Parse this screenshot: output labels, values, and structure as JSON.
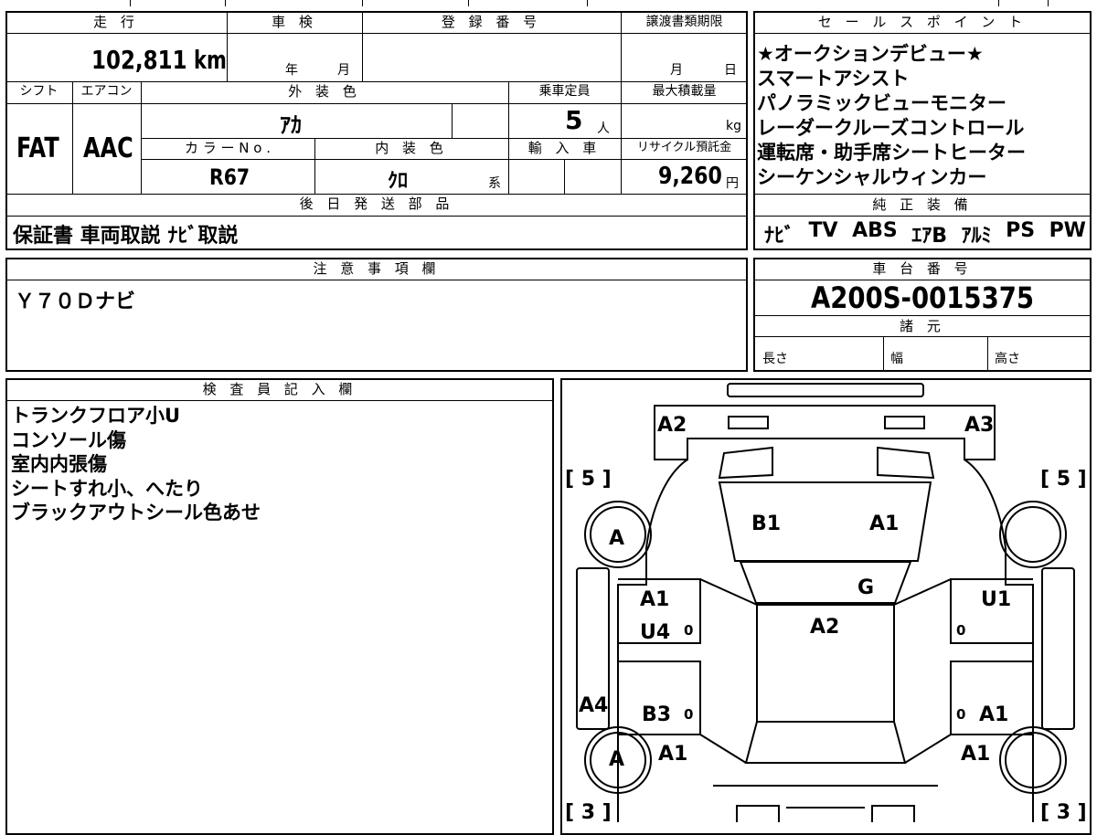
{
  "header": {
    "mileage_label": "走 行",
    "mileage_value": "102,811",
    "mileage_unit": "km",
    "inspection_label": "車 検",
    "inspection_year": "年",
    "inspection_month": "月",
    "registration_label": "登 録 番 号",
    "transfer_label": "譲渡書類期限",
    "transfer_month": "月",
    "transfer_day": "日"
  },
  "specs": {
    "shift_label": "シフト",
    "shift_value": "FAT",
    "ac_label": "エアコン",
    "ac_value": "AAC",
    "exterior_color_label": "外 装 色",
    "exterior_color_value": "ｱｶ",
    "capacity_label": "乗車定員",
    "capacity_value": "5",
    "capacity_unit": "人",
    "max_load_label": "最大積載量",
    "max_load_unit": "kg",
    "color_no_label": "カ ラ ー N o .",
    "color_no_value": "R67",
    "interior_color_label": "内 装 色",
    "interior_color_value": "ｸﾛ",
    "interior_color_suffix": "系",
    "import_label": "輸 入 車",
    "recycle_label": "リサイクル預託金",
    "recycle_value": "9,260",
    "recycle_unit": "円"
  },
  "later_parts": {
    "label": "後 日 発 送 部 品",
    "value": "保証書 車両取説 ﾅﾋﾞ取説"
  },
  "sales_points": {
    "label": "セ ー ル ス ポ イ ン ト",
    "items": [
      "★オークションデビュー★",
      "スマートアシスト",
      "パノラミックビューモニター",
      "レーダークルーズコントロール",
      "運転席・助手席シートヒーター",
      "シーケンシャルウィンカー"
    ]
  },
  "equipment": {
    "label": "純 正 装 備",
    "items": [
      "ﾅﾋﾞ",
      "TV",
      "ABS",
      "ｴｱB",
      "ｱﾙﾐ",
      "PS",
      "PW"
    ]
  },
  "notes": {
    "label": "注 意 事 項 欄",
    "value": "Ｙ７０Ｄナビ"
  },
  "chassis": {
    "label": "車 台 番 号",
    "value": "A200S-0015375",
    "spec_label": "諸 元",
    "length_label": "長さ",
    "width_label": "幅",
    "height_label": "高さ"
  },
  "inspector": {
    "label": "検 査 員 記 入 欄",
    "lines": [
      "トランクフロア小U",
      "コンソール傷",
      "室内内張傷",
      "シートすれ小、へたり",
      "ブラックアウトシール色あせ"
    ]
  },
  "diagram": {
    "tire_fl": "[ 5 ]",
    "tire_fr": "[ 5 ]",
    "tire_rl": "[ 3 ]",
    "tire_rr": "[ 3 ]",
    "codes": {
      "a2_top_left": "A2",
      "a3_top_right": "A3",
      "b1_hood": "B1",
      "a1_hood": "A1",
      "g_windshield": "G",
      "a_wheel_front": "A",
      "a1_left_front_door": "A1",
      "u4_left_front_door": "U4",
      "u1_right_front_door": "U1",
      "a2_roof": "A2",
      "a4_left_side": "A4",
      "b3_left_rear_door": "B3",
      "a1_right_rear_door": "A1",
      "a_wheel_rear": "A",
      "a1_left_rear_fender": "A1",
      "a1_right_rear_fender": "A1",
      "zero1": "0",
      "zero2": "0",
      "zero3": "0",
      "zero4": "0"
    }
  }
}
